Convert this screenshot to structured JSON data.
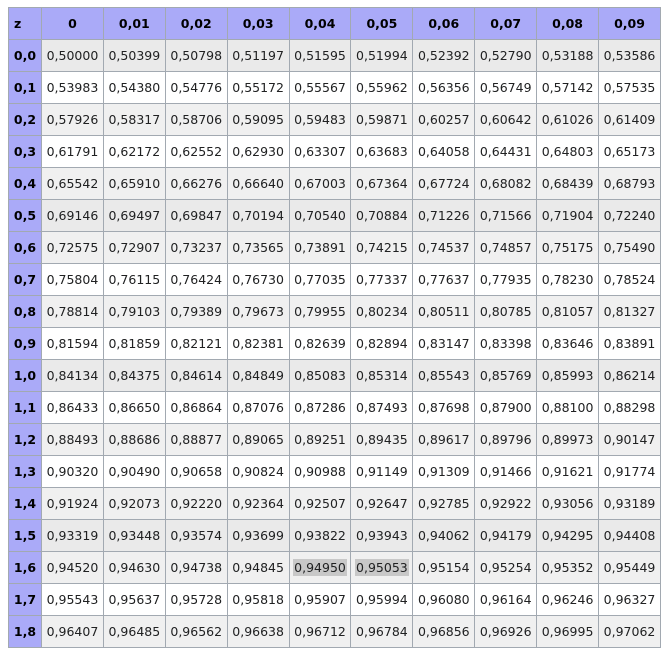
{
  "table": {
    "header": [
      "z",
      "0",
      "0,01",
      "0,02",
      "0,03",
      "0,04",
      "0,05",
      "0,06",
      "0,07",
      "0,08",
      "0,09"
    ],
    "rows": [
      {
        "z": "0,0",
        "values": [
          "0,50000",
          "0,50399",
          "0,50798",
          "0,51197",
          "0,51595",
          "0,51994",
          "0,52392",
          "0,52790",
          "0,53188",
          "0,53586"
        ]
      },
      {
        "z": "0,1",
        "values": [
          "0,53983",
          "0,54380",
          "0,54776",
          "0,55172",
          "0,55567",
          "0,55962",
          "0,56356",
          "0,56749",
          "0,57142",
          "0,57535"
        ]
      },
      {
        "z": "0,2",
        "values": [
          "0,57926",
          "0,58317",
          "0,58706",
          "0,59095",
          "0,59483",
          "0,59871",
          "0,60257",
          "0,60642",
          "0,61026",
          "0,61409"
        ]
      },
      {
        "z": "0,3",
        "values": [
          "0,61791",
          "0,62172",
          "0,62552",
          "0,62930",
          "0,63307",
          "0,63683",
          "0,64058",
          "0,64431",
          "0,64803",
          "0,65173"
        ]
      },
      {
        "z": "0,4",
        "values": [
          "0,65542",
          "0,65910",
          "0,66276",
          "0,66640",
          "0,67003",
          "0,67364",
          "0,67724",
          "0,68082",
          "0,68439",
          "0,68793"
        ]
      },
      {
        "z": "0,5",
        "values": [
          "0,69146",
          "0,69497",
          "0,69847",
          "0,70194",
          "0,70540",
          "0,70884",
          "0,71226",
          "0,71566",
          "0,71904",
          "0,72240"
        ]
      },
      {
        "z": "0,6",
        "values": [
          "0,72575",
          "0,72907",
          "0,73237",
          "0,73565",
          "0,73891",
          "0,74215",
          "0,74537",
          "0,74857",
          "0,75175",
          "0,75490"
        ]
      },
      {
        "z": "0,7",
        "values": [
          "0,75804",
          "0,76115",
          "0,76424",
          "0,76730",
          "0,77035",
          "0,77337",
          "0,77637",
          "0,77935",
          "0,78230",
          "0,78524"
        ]
      },
      {
        "z": "0,8",
        "values": [
          "0,78814",
          "0,79103",
          "0,79389",
          "0,79673",
          "0,79955",
          "0,80234",
          "0,80511",
          "0,80785",
          "0,81057",
          "0,81327"
        ]
      },
      {
        "z": "0,9",
        "values": [
          "0,81594",
          "0,81859",
          "0,82121",
          "0,82381",
          "0,82639",
          "0,82894",
          "0,83147",
          "0,83398",
          "0,83646",
          "0,83891"
        ]
      },
      {
        "z": "1,0",
        "values": [
          "0,84134",
          "0,84375",
          "0,84614",
          "0,84849",
          "0,85083",
          "0,85314",
          "0,85543",
          "0,85769",
          "0,85993",
          "0,86214"
        ]
      },
      {
        "z": "1,1",
        "values": [
          "0,86433",
          "0,86650",
          "0,86864",
          "0,87076",
          "0,87286",
          "0,87493",
          "0,87698",
          "0,87900",
          "0,88100",
          "0,88298"
        ]
      },
      {
        "z": "1,2",
        "values": [
          "0,88493",
          "0,88686",
          "0,88877",
          "0,89065",
          "0,89251",
          "0,89435",
          "0,89617",
          "0,89796",
          "0,89973",
          "0,90147"
        ]
      },
      {
        "z": "1,3",
        "values": [
          "0,90320",
          "0,90490",
          "0,90658",
          "0,90824",
          "0,90988",
          "0,91149",
          "0,91309",
          "0,91466",
          "0,91621",
          "0,91774"
        ]
      },
      {
        "z": "1,4",
        "values": [
          "0,91924",
          "0,92073",
          "0,92220",
          "0,92364",
          "0,92507",
          "0,92647",
          "0,92785",
          "0,92922",
          "0,93056",
          "0,93189"
        ]
      },
      {
        "z": "1,5",
        "values": [
          "0,93319",
          "0,93448",
          "0,93574",
          "0,93699",
          "0,93822",
          "0,93943",
          "0,94062",
          "0,94179",
          "0,94295",
          "0,94408"
        ]
      },
      {
        "z": "1,6",
        "values": [
          "0,94520",
          "0,94630",
          "0,94738",
          "0,94845",
          "0,94950",
          "0,95053",
          "0,95154",
          "0,95254",
          "0,95352",
          "0,95449"
        ],
        "highlight": [
          4,
          5
        ]
      },
      {
        "z": "1,7",
        "values": [
          "0,95543",
          "0,95637",
          "0,95728",
          "0,95818",
          "0,95907",
          "0,95994",
          "0,96080",
          "0,96164",
          "0,96246",
          "0,96327"
        ]
      },
      {
        "z": "1,8",
        "values": [
          "0,96407",
          "0,96485",
          "0,96562",
          "0,96638",
          "0,96712",
          "0,96784",
          "0,96856",
          "0,96926",
          "0,96995",
          "0,97062"
        ]
      }
    ]
  },
  "colors": {
    "header_bg": "#aaaaf8",
    "border": "#a2a9b1",
    "row_odd": "#f0f0f0",
    "highlight": "#c8c8c8"
  }
}
